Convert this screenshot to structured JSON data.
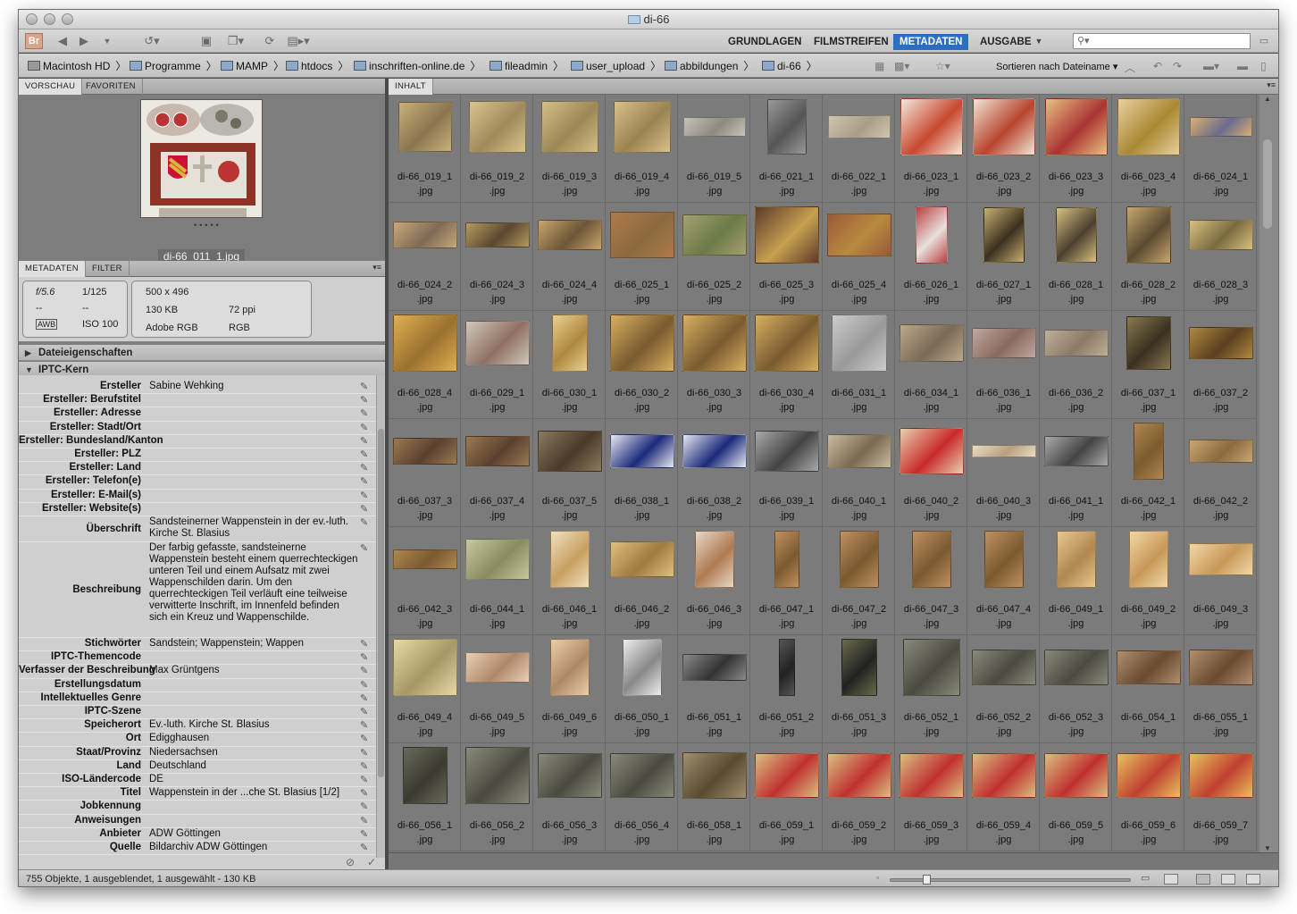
{
  "window": {
    "title": "di-66"
  },
  "toolbar": {
    "logo": "Br",
    "icons": [
      "back-icon",
      "forward-icon",
      "menu-down-icon",
      "history-icon",
      "camera-icon",
      "copy-icon",
      "refresh-icon",
      "open-icon"
    ],
    "workspaces": [
      "GRUNDLAGEN",
      "FILMSTREIFEN",
      "METADATEN",
      "AUSGABE"
    ],
    "active_workspace": "METADATEN",
    "search_placeholder": ""
  },
  "path": [
    {
      "label": "Macintosh HD",
      "icon": "disk-icon"
    },
    {
      "label": "Programme",
      "icon": "folder-icon"
    },
    {
      "label": "MAMP",
      "icon": "folder-icon"
    },
    {
      "label": "htdocs",
      "icon": "folder-icon"
    },
    {
      "label": "inschriften-online.de",
      "icon": "folder-icon"
    },
    {
      "label": "fileadmin",
      "icon": "folder-icon"
    },
    {
      "label": "user_upload",
      "icon": "folder-icon"
    },
    {
      "label": "abbildungen",
      "icon": "folder-icon"
    },
    {
      "label": "di-66",
      "icon": "folder-icon"
    }
  ],
  "sort_label": "Sortieren nach Dateiname",
  "left_panel": {
    "tabs": [
      "VORSCHAU",
      "FAVORITEN"
    ],
    "preview_filename": "di-66_011_1.jpg",
    "meta_tabs": [
      "METADATEN",
      "FILTER"
    ],
    "camera": {
      "aperture": "f/5.6",
      "shutter": "1/125",
      "wb": "AWB",
      "iso": "ISO 100",
      "dash1": "--",
      "dash2": "--"
    },
    "file": {
      "dimensions": "500 x 496",
      "size": "130 KB",
      "resolution": "72 ppi",
      "colorprofile": "Adobe RGB",
      "colormode": "RGB"
    },
    "sections": [
      "Dateieigenschaften",
      "IPTC-Kern"
    ],
    "iptc": [
      {
        "label": "Ersteller",
        "value": "Sabine Wehking"
      },
      {
        "label": "Ersteller: Berufstitel",
        "value": ""
      },
      {
        "label": "Ersteller: Adresse",
        "value": ""
      },
      {
        "label": "Ersteller: Stadt/Ort",
        "value": ""
      },
      {
        "label": "Ersteller: Bundesland/Kanton",
        "value": ""
      },
      {
        "label": "Ersteller: PLZ",
        "value": ""
      },
      {
        "label": "Ersteller: Land",
        "value": ""
      },
      {
        "label": "Ersteller: Telefon(e)",
        "value": ""
      },
      {
        "label": "Ersteller: E-Mail(s)",
        "value": ""
      },
      {
        "label": "Ersteller: Website(s)",
        "value": ""
      },
      {
        "label": "Überschrift",
        "value": "Sandsteinerner Wappenstein in der ev.-luth. Kirche St. Blasius"
      },
      {
        "label": "Beschreibung",
        "value": "Der farbig gefasste, sandsteinerne Wappenstein besteht einem querrechteckigen unteren Teil und einem Aufsatz mit zwei Wappenschilden darin. Um den querrechteckigen Teil verläuft eine teilweise verwitterte Inschrift, im Innenfeld befinden sich ein Kreuz und Wappenschilde."
      },
      {
        "label": "Stichwörter",
        "value": "Sandstein; Wappenstein; Wappen"
      },
      {
        "label": "IPTC-Themencode",
        "value": ""
      },
      {
        "label": "Verfasser der Beschreibung",
        "value": "Max Grüntgens"
      },
      {
        "label": "Erstellungsdatum",
        "value": ""
      },
      {
        "label": "Intellektuelles Genre",
        "value": ""
      },
      {
        "label": "IPTC-Szene",
        "value": ""
      },
      {
        "label": "Speicherort",
        "value": "Ev.-luth. Kirche St. Blasius"
      },
      {
        "label": "Ort",
        "value": "Edigghausen"
      },
      {
        "label": "Staat/Provinz",
        "value": "Niedersachsen"
      },
      {
        "label": "Land",
        "value": "Deutschland"
      },
      {
        "label": "ISO-Ländercode",
        "value": "DE"
      },
      {
        "label": "Titel",
        "value": "Wappenstein in der ...che St. Blasius [1/2]"
      },
      {
        "label": "Jobkennung",
        "value": ""
      },
      {
        "label": "Anweisungen",
        "value": ""
      },
      {
        "label": "Anbieter",
        "value": "ADW Göttingen"
      },
      {
        "label": "Quelle",
        "value": "Bildarchiv ADW Göttingen"
      }
    ]
  },
  "content": {
    "tab": "INHALT",
    "ext": ".jpg",
    "files": [
      "di-66_019_1",
      "di-66_019_2",
      "di-66_019_3",
      "di-66_019_4",
      "di-66_019_5",
      "di-66_021_1",
      "di-66_022_1",
      "di-66_023_1",
      "di-66_023_2",
      "di-66_023_3",
      "di-66_023_4",
      "di-66_024_1",
      "di-66_024_2",
      "di-66_024_3",
      "di-66_024_4",
      "di-66_025_1",
      "di-66_025_2",
      "di-66_025_3",
      "di-66_025_4",
      "di-66_026_1",
      "di-66_027_1",
      "di-66_028_1",
      "di-66_028_2",
      "di-66_028_3",
      "di-66_028_4",
      "di-66_029_1",
      "di-66_030_1",
      "di-66_030_2",
      "di-66_030_3",
      "di-66_030_4",
      "di-66_031_1",
      "di-66_034_1",
      "di-66_036_1",
      "di-66_036_2",
      "di-66_037_1",
      "di-66_037_2",
      "di-66_037_3",
      "di-66_037_4",
      "di-66_037_5",
      "di-66_038_1",
      "di-66_038_2",
      "di-66_039_1",
      "di-66_040_1",
      "di-66_040_2",
      "di-66_040_3",
      "di-66_041_1",
      "di-66_042_1",
      "di-66_042_2",
      "di-66_042_3",
      "di-66_044_1",
      "di-66_046_1",
      "di-66_046_2",
      "di-66_046_3",
      "di-66_047_1",
      "di-66_047_2",
      "di-66_047_3",
      "di-66_047_4",
      "di-66_049_1",
      "di-66_049_2",
      "di-66_049_3",
      "di-66_049_4",
      "di-66_049_5",
      "di-66_049_6",
      "di-66_050_1",
      "di-66_051_1",
      "di-66_051_2",
      "di-66_051_3",
      "di-66_052_1",
      "di-66_052_2",
      "di-66_052_3",
      "di-66_054_1",
      "di-66_055_1",
      "di-66_056_1",
      "di-66_056_2",
      "di-66_056_3",
      "di-66_056_4",
      "di-66_058_1",
      "di-66_059_1",
      "di-66_059_2",
      "di-66_059_3",
      "di-66_059_4",
      "di-66_059_5",
      "di-66_059_6",
      "di-66_059_7"
    ]
  },
  "status": {
    "text": "755 Objekte, 1 ausgeblendet, 1 ausgewählt - 130 KB"
  }
}
